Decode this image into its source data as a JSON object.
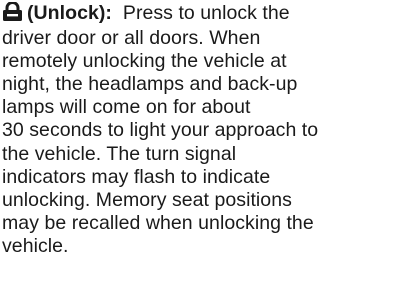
{
  "entry": {
    "icon": "unlock-icon",
    "term": "(Unlock):",
    "lines": [
      "Press to unlock the",
      "driver door or all doors. When",
      "remotely unlocking the vehicle at",
      "night, the headlamps and back-up",
      "lamps will come on for about",
      "30 seconds to light your approach to",
      "the vehicle. The turn signal",
      "indicators may flash to indicate",
      "unlocking. Memory seat positions",
      "may be recalled when unlocking the",
      "vehicle."
    ]
  }
}
